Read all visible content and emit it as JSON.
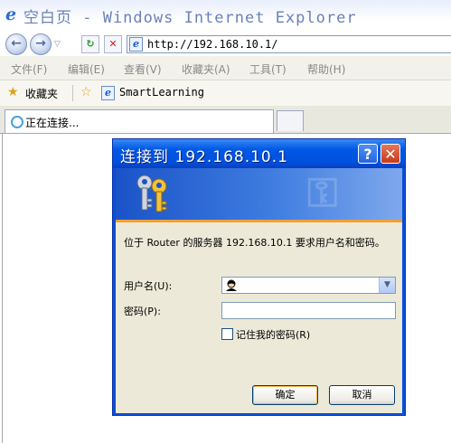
{
  "window": {
    "title": "空白页 - Windows Internet Explorer"
  },
  "address_bar": {
    "url": "http://192.168.10.1/",
    "back_glyph": "←",
    "forward_glyph": "→",
    "refresh_glyph": "↻",
    "stop_glyph": "✕"
  },
  "menu": {
    "items": [
      {
        "label": "文件(F)"
      },
      {
        "label": "编辑(E)"
      },
      {
        "label": "查看(V)"
      },
      {
        "label": "收藏夹(A)"
      },
      {
        "label": "工具(T)"
      },
      {
        "label": "帮助(H)"
      }
    ]
  },
  "favorites_bar": {
    "favorites_label": "收藏夹",
    "site_label": "SmartLearning"
  },
  "tab": {
    "label": "正在连接..."
  },
  "dialog": {
    "title": "连接到 192.168.10.1",
    "help_glyph": "?",
    "close_glyph": "✕",
    "prompt": "位于 Router 的服务器 192.168.10.1 要求用户名和密码。",
    "username_label": "用户名(U):",
    "username_value": "",
    "password_label": "密码(P):",
    "password_value": "",
    "remember_label": "记住我的密码(R)",
    "remember_checked": false,
    "ok_label": "确定",
    "cancel_label": "取消"
  },
  "colors": {
    "titlebar_blue": "#0058e6",
    "dialog_face": "#ece9d8",
    "banner_accent": "#f0a035"
  }
}
